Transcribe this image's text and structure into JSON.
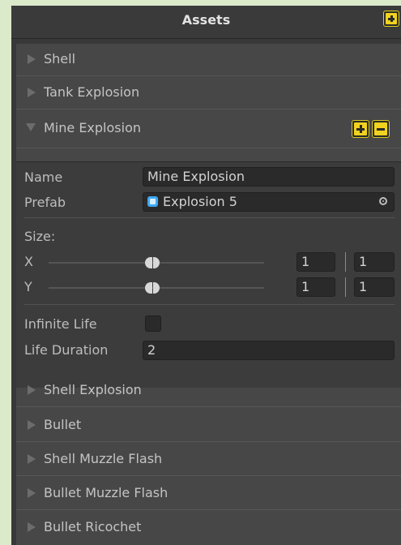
{
  "header": {
    "title": "Assets"
  },
  "list": {
    "items": [
      {
        "label": "Shell",
        "expanded": false
      },
      {
        "label": "Tank Explosion",
        "expanded": false
      },
      {
        "label": "Mine Explosion",
        "expanded": true
      },
      {
        "label": "Shell Explosion",
        "expanded": false
      },
      {
        "label": "Bullet",
        "expanded": false
      },
      {
        "label": "Shell Muzzle Flash",
        "expanded": false
      },
      {
        "label": "Bullet Muzzle Flash",
        "expanded": false
      },
      {
        "label": "Bullet Ricochet",
        "expanded": false
      }
    ]
  },
  "detail": {
    "name_label": "Name",
    "name_value": "Mine Explosion",
    "prefab_label": "Prefab",
    "prefab_value": "Explosion 5",
    "size_label": "Size:",
    "x_label": "X",
    "x_min": "1",
    "x_max": "1",
    "y_label": "Y",
    "y_min": "1",
    "y_max": "1",
    "infinite_life_label": "Infinite Life",
    "infinite_life": false,
    "life_duration_label": "Life Duration",
    "life_duration_value": "2"
  },
  "colors": {
    "accent": "#f1d21e",
    "prefab_icon": "#3fa9f5",
    "panel": "#474747"
  },
  "icons": [
    "plus-icon",
    "minus-icon",
    "expand-arrow-icon",
    "collapse-arrow-icon",
    "prefab-cube-icon",
    "object-picker-icon"
  ]
}
